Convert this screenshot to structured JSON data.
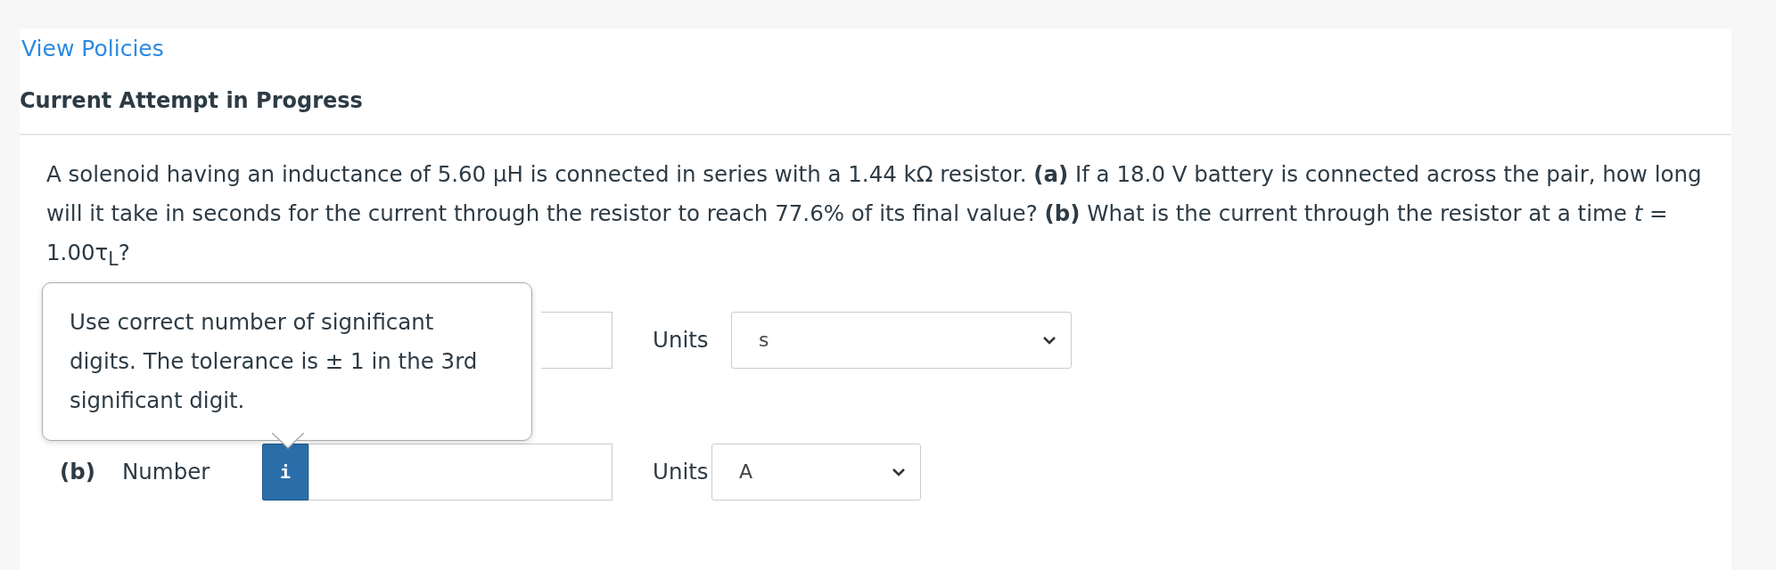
{
  "link": "View Policies",
  "heading": "Current Attempt in Progress",
  "question": "A solenoid having an inductance of 5.60 μH is connected in series with a 1.44 kΩ resistor. **(a)** If a 18.0 V battery is connected across the pair, how long will it take in seconds for the current through the resistor to reach 77.6% of its final value? **(b)** What is the current through the resistor at a time *t* = 1.00τ$_{L}$?",
  "tooltip": "Use correct number of significant digits. The tolerance is ± 1 in the 3rd significant digit.",
  "answers": [
    {
      "kind": "covered",
      "units_label": "Units",
      "units": "s"
    },
    {
      "kind": "labeled",
      "part": "(b)",
      "label": "Number",
      "icon": "i",
      "units_label": "Units",
      "units": "A"
    }
  ]
}
